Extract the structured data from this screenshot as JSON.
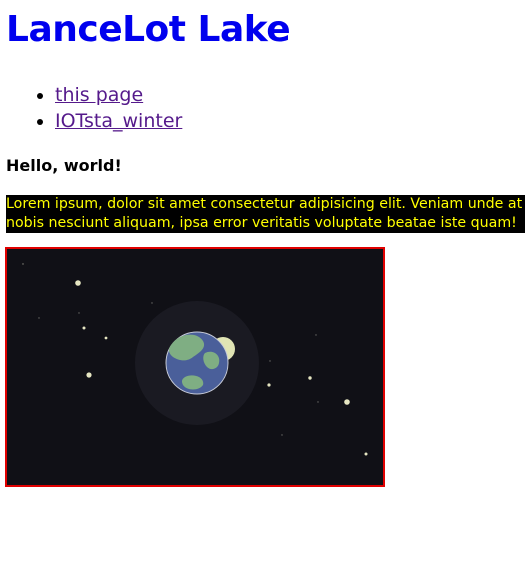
{
  "header": {
    "title": "LanceLot Lake"
  },
  "nav": {
    "items": [
      {
        "label": "this page"
      },
      {
        "label": "IOTsta_winter"
      }
    ]
  },
  "greeting": "Hello, world!",
  "banner": {
    "line1": "Lorem ipsum, dolor sit amet consectetur adipisicing elit. Veniam unde at",
    "line2": "nobis nesciunt aliquam, ipsa error veritatis voluptate beatae iste quam!",
    "text_color": "#ffff00",
    "background_color": "#000000"
  },
  "space_scene": {
    "frame_border_color": "#e00000",
    "background_color": "#101016",
    "planet_ocean_color": "#4a5f9a",
    "planet_land_color": "#7fae83",
    "moon_color": "#e0e4b4",
    "star_color": "#e6e6c2"
  }
}
